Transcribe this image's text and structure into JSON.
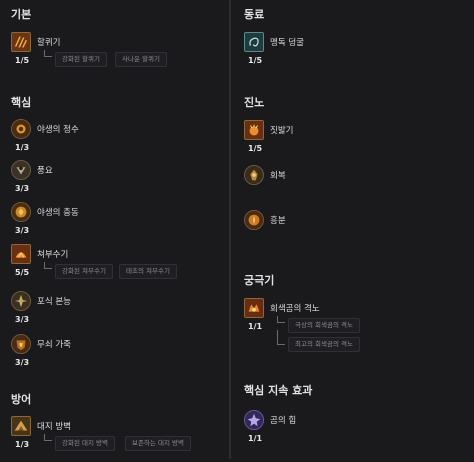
{
  "left": {
    "sections": [
      {
        "title": "기본",
        "skills": [
          {
            "name": "할퀴기",
            "rank": "1/5",
            "icon": "claw-icon",
            "upgrades": [
              "강화된 할퀴기",
              "사나운 할퀴기"
            ]
          }
        ]
      },
      {
        "title": "핵심",
        "skills": [
          {
            "name": "야생의 정수",
            "rank": "1/3",
            "icon": "wild-essence-icon"
          },
          {
            "name": "풍요",
            "rank": "3/3",
            "icon": "abundance-icon"
          },
          {
            "name": "야생의 충동",
            "rank": "3/3",
            "icon": "wild-impulse-icon"
          },
          {
            "name": "쳐부수기",
            "rank": "5/5",
            "icon": "maul-icon",
            "upgrades": [
              "강화된 쳐부수기",
              "태초의 쳐부수기"
            ]
          },
          {
            "name": "포식 본능",
            "rank": "3/3",
            "icon": "predatory-instinct-icon"
          },
          {
            "name": "무쇠 가죽",
            "rank": "3/3",
            "icon": "iron-fur-icon"
          }
        ]
      },
      {
        "title": "방어",
        "skills": [
          {
            "name": "대지 방벽",
            "rank": "1/3",
            "icon": "earthen-bulwark-icon",
            "upgrades": [
              "강화된 대지 방벽",
              "보존하는 대지 방벽"
            ]
          }
        ]
      }
    ]
  },
  "right": {
    "sections": [
      {
        "title": "동료",
        "skills": [
          {
            "name": "맹독 덩굴",
            "rank": "1/5",
            "icon": "poison-creeper-icon"
          }
        ]
      },
      {
        "title": "진노",
        "skills": [
          {
            "name": "짓밟기",
            "rank": "1/5",
            "icon": "trample-icon"
          },
          {
            "name": "회복",
            "rank": "",
            "icon": "heal-icon"
          },
          {
            "name": "흥분",
            "rank": "",
            "icon": "frenzy-icon"
          }
        ]
      },
      {
        "title": "궁극기",
        "skills": [
          {
            "name": "회색곰의 격노",
            "rank": "1/1",
            "icon": "grizzly-rage-icon",
            "upgrades": [
              "극상의 회색곰의 격노",
              "최고의 회색곰의 격노"
            ]
          }
        ]
      },
      {
        "title": "핵심 지속 효과",
        "skills": [
          {
            "name": "곰의 힘",
            "rank": "1/1",
            "icon": "ursine-strength-icon"
          }
        ]
      }
    ]
  }
}
